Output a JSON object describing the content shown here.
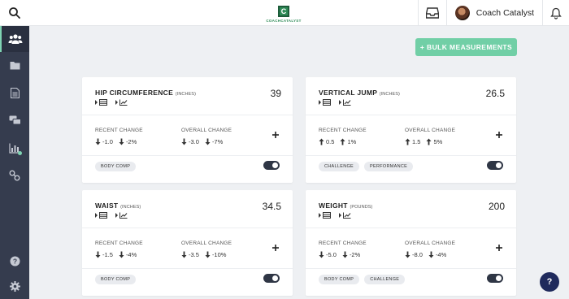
{
  "brand": {
    "logo_letter": "C",
    "logo_text": "COACHCATALYST",
    "color": "#2e8b57"
  },
  "user": {
    "name": "Coach Catalyst"
  },
  "icons": {
    "search": "search-icon",
    "inbox": "inbox-icon",
    "bell": "bell-icon"
  },
  "sidebar": {
    "items": [
      {
        "icon": "clients-icon",
        "active": true
      },
      {
        "icon": "folder-icon"
      },
      {
        "icon": "document-icon"
      },
      {
        "icon": "messages-icon"
      },
      {
        "icon": "chart-icon"
      },
      {
        "icon": "integrations-icon"
      }
    ],
    "bottom": [
      {
        "icon": "help-icon"
      },
      {
        "icon": "gear-icon"
      }
    ]
  },
  "actions": {
    "bulk_label": "+ BULK MEASUREMENTS",
    "accent": "#71cfa6"
  },
  "labels": {
    "recent": "RECENT CHANGE",
    "overall": "OVERALL CHANGE"
  },
  "cards": [
    {
      "title": "HIP CIRCUMFERENCE",
      "unit": "(INCHES)",
      "value": "39",
      "recent": [
        {
          "dir": "down",
          "text": "-1.0"
        },
        {
          "dir": "down",
          "text": "-2%"
        }
      ],
      "overall": [
        {
          "dir": "down",
          "text": "-3.0"
        },
        {
          "dir": "down",
          "text": "-7%"
        }
      ],
      "tags": [
        "BODY COMP"
      ],
      "enabled": true
    },
    {
      "title": "VERTICAL JUMP",
      "unit": "(INCHES)",
      "value": "26.5",
      "recent": [
        {
          "dir": "up",
          "text": "0.5"
        },
        {
          "dir": "up",
          "text": "1%"
        }
      ],
      "overall": [
        {
          "dir": "up",
          "text": "1.5"
        },
        {
          "dir": "up",
          "text": "5%"
        }
      ],
      "tags": [
        "CHALLENGE",
        "PERFORMANCE"
      ],
      "enabled": true
    },
    {
      "title": "WAIST",
      "unit": "(INCHES)",
      "value": "34.5",
      "recent": [
        {
          "dir": "down",
          "text": "-1.5"
        },
        {
          "dir": "down",
          "text": "-4%"
        }
      ],
      "overall": [
        {
          "dir": "down",
          "text": "-3.5"
        },
        {
          "dir": "down",
          "text": "-10%"
        }
      ],
      "tags": [
        "BODY COMP"
      ],
      "enabled": true
    },
    {
      "title": "WEIGHT",
      "unit": "(POUNDS)",
      "value": "200",
      "recent": [
        {
          "dir": "down",
          "text": "-5.0"
        },
        {
          "dir": "down",
          "text": "-2%"
        }
      ],
      "overall": [
        {
          "dir": "down",
          "text": "-8.0"
        },
        {
          "dir": "down",
          "text": "-4%"
        }
      ],
      "tags": [
        "BODY COMP",
        "CHALLENGE"
      ],
      "enabled": true
    }
  ],
  "help": {
    "label": "?"
  }
}
